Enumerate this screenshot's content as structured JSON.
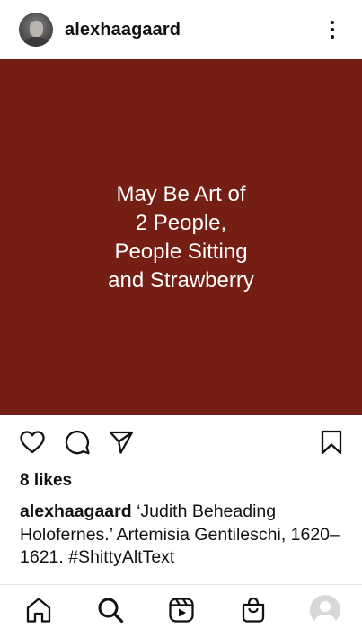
{
  "header": {
    "username": "alexhaagaard",
    "avatar_icon": "user-photo-avatar",
    "more_icon": "three-dots-vertical-icon"
  },
  "post": {
    "image_text": "May Be Art of\n2 People,\nPeople Sitting\nand Strawberry",
    "image_background": "#751e14"
  },
  "actions": {
    "like_icon": "heart-icon",
    "comment_icon": "comment-bubble-icon",
    "share_icon": "paper-plane-icon",
    "save_icon": "bookmark-icon"
  },
  "likes": "8 likes",
  "caption": {
    "username": "alexhaagaard",
    "text": "‘Judith Beheading Holofernes.’ Artemisia Gentileschi, 1620–1621. #ShittyAltText"
  },
  "bottom_nav": {
    "items": [
      "home-icon",
      "search-icon",
      "reels-icon",
      "shop-icon",
      "profile-avatar"
    ]
  }
}
